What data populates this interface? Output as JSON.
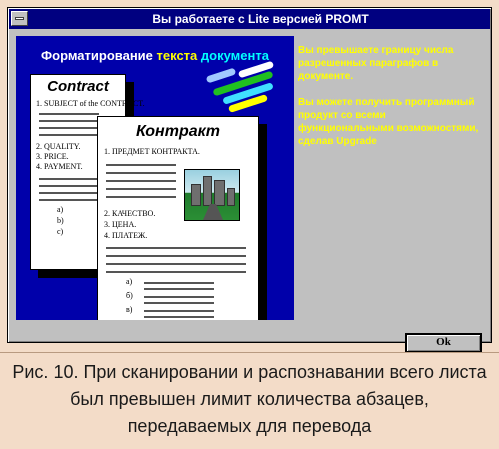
{
  "window": {
    "title": "Вы работаете с Lite версией PROMT"
  },
  "illustration": {
    "heading_part1": "Форматирование ",
    "heading_part2": "текста ",
    "heading_part3": "документа",
    "doc_en": {
      "title": "Contract",
      "lines": [
        "1. SUBJECT of the CONTRACT.",
        "2. QUALITY.",
        "3. PRICE.",
        "4. PAYMENT."
      ],
      "subitems": [
        "a)",
        "b)",
        "c)"
      ]
    },
    "doc_ru": {
      "title": "Контракт",
      "lines": [
        "1. ПРЕДМЕТ КОНТРАКТА.",
        "2. КАЧЕСТВО.",
        "3. ЦЕНА.",
        "4. ПЛАТЕЖ."
      ],
      "subitems": [
        "а)",
        "б)",
        "в)"
      ]
    }
  },
  "message": {
    "paragraph1": "Вы превышаете границу числа разрешенных параграфов в документе.",
    "paragraph2": "Вы можете получить программный продукт со всеми функциональными возможностями, сделав Upgrade"
  },
  "buttons": {
    "ok_label": "Ok"
  },
  "caption": {
    "text": "Рис. 10. При сканировании и распознавании всего листа был превышен лимит количества абзацев, передаваемых для перевода"
  },
  "colors": {
    "titlebar": "#000080",
    "art_background": "#0000aa",
    "message_text": "#ffff00",
    "dialog_face": "#c0c0c0"
  }
}
